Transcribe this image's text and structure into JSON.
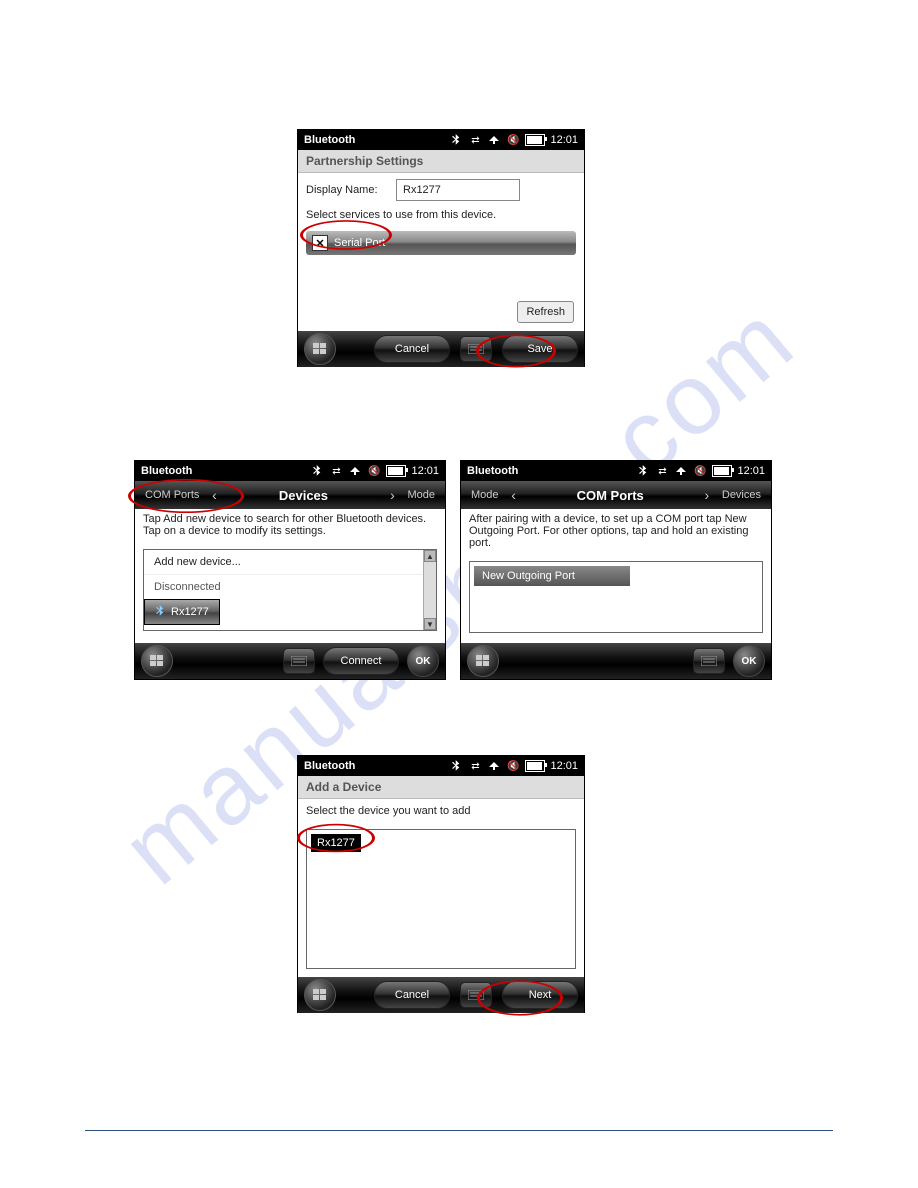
{
  "watermark": "manualshive.com",
  "status": {
    "time": "12:01"
  },
  "screen1": {
    "title": "Bluetooth",
    "section": "Partnership Settings",
    "display_name_label": "Display Name:",
    "display_name_value": "Rx1277",
    "services_instruction": "Select services to use from this device.",
    "service1": "Serial Port",
    "refresh": "Refresh",
    "cancel": "Cancel",
    "save": "Save"
  },
  "screen2": {
    "title": "Bluetooth",
    "tab_left": "COM Ports",
    "tab_center": "Devices",
    "tab_right": "Mode",
    "instruction": "Tap Add new device to search for other Bluetooth devices. Tap on a device to modify its settings.",
    "add_new": "Add new device...",
    "group": "Disconnected",
    "device": "Rx1277",
    "connect": "Connect",
    "ok": "OK"
  },
  "screen3": {
    "title": "Bluetooth",
    "tab_left": "Mode",
    "tab_center": "COM Ports",
    "tab_right": "Devices",
    "instruction": "After pairing with a device, to set up a COM port tap New Outgoing Port. For other options, tap and hold an existing port.",
    "new_port": "New Outgoing Port",
    "ok": "OK"
  },
  "screen4": {
    "title": "Bluetooth",
    "section": "Add a Device",
    "instruction": "Select the device you want to add",
    "device": "Rx1277",
    "cancel": "Cancel",
    "next": "Next"
  }
}
